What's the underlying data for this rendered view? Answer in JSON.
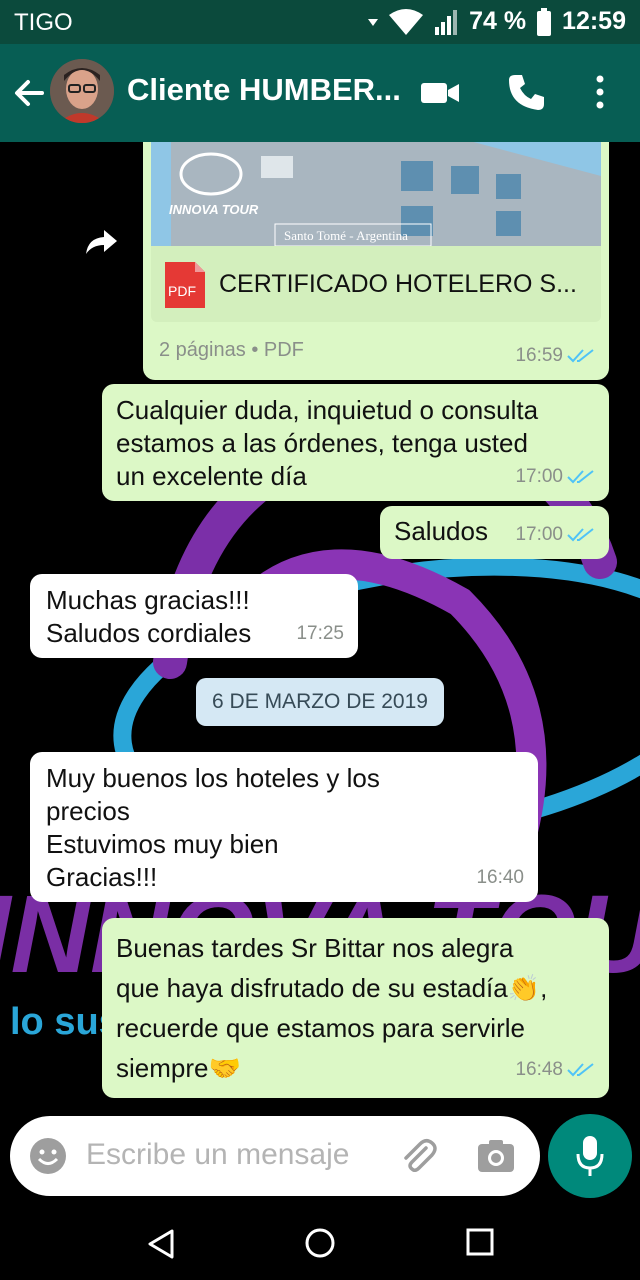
{
  "status_bar": {
    "carrier": "TIGO",
    "battery": "74 %",
    "time": "12:59"
  },
  "header": {
    "contact_name": "Cliente HUMBER..."
  },
  "document": {
    "banner_brand": "INNOVA TOUR",
    "banner_location": "Santo Tomé - Argentina",
    "file_type_badge": "PDF",
    "file_name": "CERTIFICADO HOTELERO S...",
    "pages": "2 páginas",
    "separator": "•",
    "type": "PDF",
    "time": "16:59"
  },
  "messages": [
    {
      "direction": "out",
      "text": "Cualquier duda, inquietud o consulta\nestamos a las órdenes, tenga usted\nun excelente día",
      "time": "17:00",
      "read": true
    },
    {
      "direction": "out",
      "text": "Saludos",
      "time": "17:00",
      "read": true
    },
    {
      "direction": "in",
      "text": "Muchas gracias!!!\nSaludos cordiales",
      "time": "17:25"
    },
    {
      "direction": "in",
      "text": "Muy buenos los hoteles y   los\nprecios\nEstuvimos muy bien\nGracias!!!",
      "time": "16:40"
    },
    {
      "direction": "out",
      "text": "Buenas tardes Sr Bittar nos alegra\nque haya disfrutado de su estadía👏,\nrecuerde que estamos para servirle\nsiempre🤝",
      "time": "16:48",
      "read": true
    }
  ],
  "date_divider": "6 DE MARZO DE 2019",
  "background": {
    "text_large": "INNOVA TOUR",
    "text_small": "lo sustentable"
  },
  "input": {
    "placeholder": "Escribe un mensaje"
  },
  "colors": {
    "header": "#075e54",
    "status_bar": "#0b4a3c",
    "outgoing_bubble": "#dcf8c6",
    "incoming_bubble": "#ffffff",
    "read_ticks": "#4fc3f7",
    "mic_button": "#00897b",
    "date_chip": "#d5e8f4"
  },
  "icons": [
    "back-arrow-icon",
    "video-call-icon",
    "phone-icon",
    "more-vert-icon",
    "forward-icon",
    "pdf-icon",
    "double-check-icon",
    "emoji-icon",
    "attach-icon",
    "camera-icon",
    "mic-icon",
    "nav-back-icon",
    "nav-home-icon",
    "nav-recents-icon"
  ]
}
